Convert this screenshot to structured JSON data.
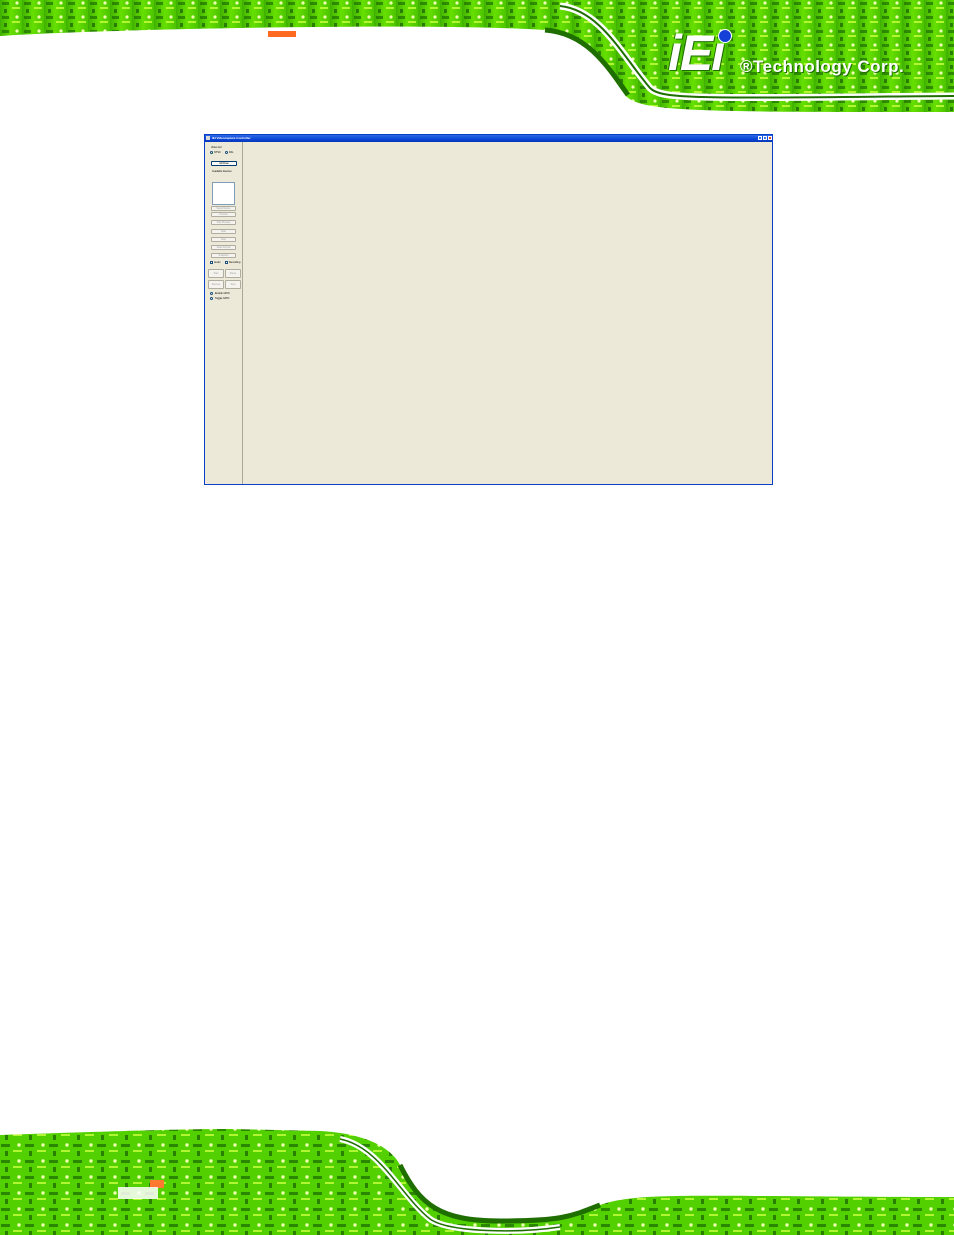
{
  "header": {
    "logo_mark": "iEi",
    "logo_text": "®Technology Corp."
  },
  "window": {
    "title": "IEI Videocapture Controller",
    "left_panel": {
      "video_std_label": "Video std",
      "video_std_options": [
        {
          "label": "NTSC",
          "selected": true
        },
        {
          "label": "PAL",
          "selected": false
        }
      ],
      "init_button": "Init/Close",
      "channels_label": "Available Devices",
      "buttons": [
        "Select Device",
        "Preview",
        "Stop Preview",
        "Start",
        "Stop",
        "Video Format",
        "Snapshot"
      ],
      "checkboxes": [
        {
          "label": "Audio",
          "checked": false
        },
        {
          "label": "Recording",
          "checked": false
        }
      ],
      "button_grid": [
        "Start",
        "Pause",
        "Resume",
        "Stop"
      ],
      "options": [
        {
          "label": "Enable GPIO",
          "selected": false
        },
        {
          "label": "Toggle GPIO",
          "selected": false
        }
      ]
    }
  },
  "colors": {
    "window_bg": "#ece9d8",
    "titlebar": "#0a46d6",
    "pcb_green": "#5ce000",
    "pcb_dark": "#1e6e00"
  }
}
